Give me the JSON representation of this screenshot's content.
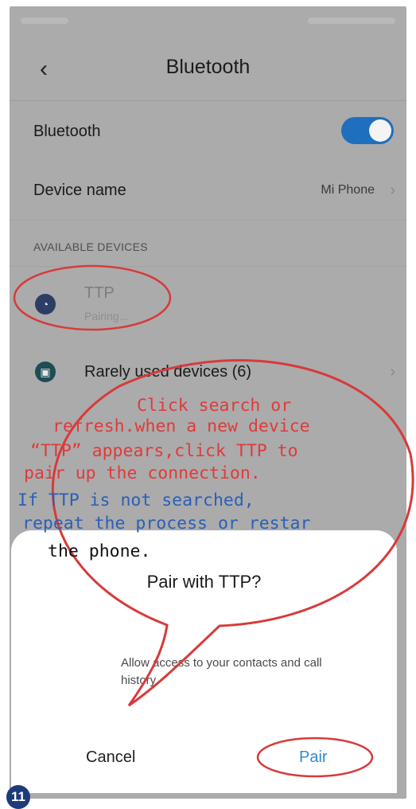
{
  "header": {
    "title": "Bluetooth"
  },
  "settings": {
    "bluetooth_label": "Bluetooth",
    "device_name_label": "Device name",
    "device_name_value": "Mi Phone"
  },
  "available_devices": {
    "section_label": "AVAILABLE DEVICES",
    "items": [
      {
        "name": "TTP",
        "status": "Pairing..."
      },
      {
        "name": "Rarely used devices (6)"
      }
    ]
  },
  "dialog": {
    "title": "Pair with TTP?",
    "message_line1": "Allow access to your contacts and call",
    "message_line2": "history",
    "cancel_label": "Cancel",
    "pair_label": "Pair"
  },
  "annotation": {
    "red_lines": [
      "Click search or",
      "refresh.when a new device",
      "“TTP” appears,click TTP to",
      "pair up the connection."
    ],
    "blue_lines": [
      "If TTP is not searched,",
      "repeat the process or restar"
    ],
    "black_line": "the phone.",
    "step_number": "11"
  },
  "colors": {
    "accent": "#1f6fbf",
    "pair_button": "#2f8ad8",
    "annotation_red": "#e03a3a",
    "annotation_blue": "#2a5fb8"
  },
  "icons": {
    "back": "chevron-left-icon",
    "device": "headset-icon",
    "rarely_used": "device-list-icon",
    "device_name_chevron": "chevron-right-icon"
  }
}
